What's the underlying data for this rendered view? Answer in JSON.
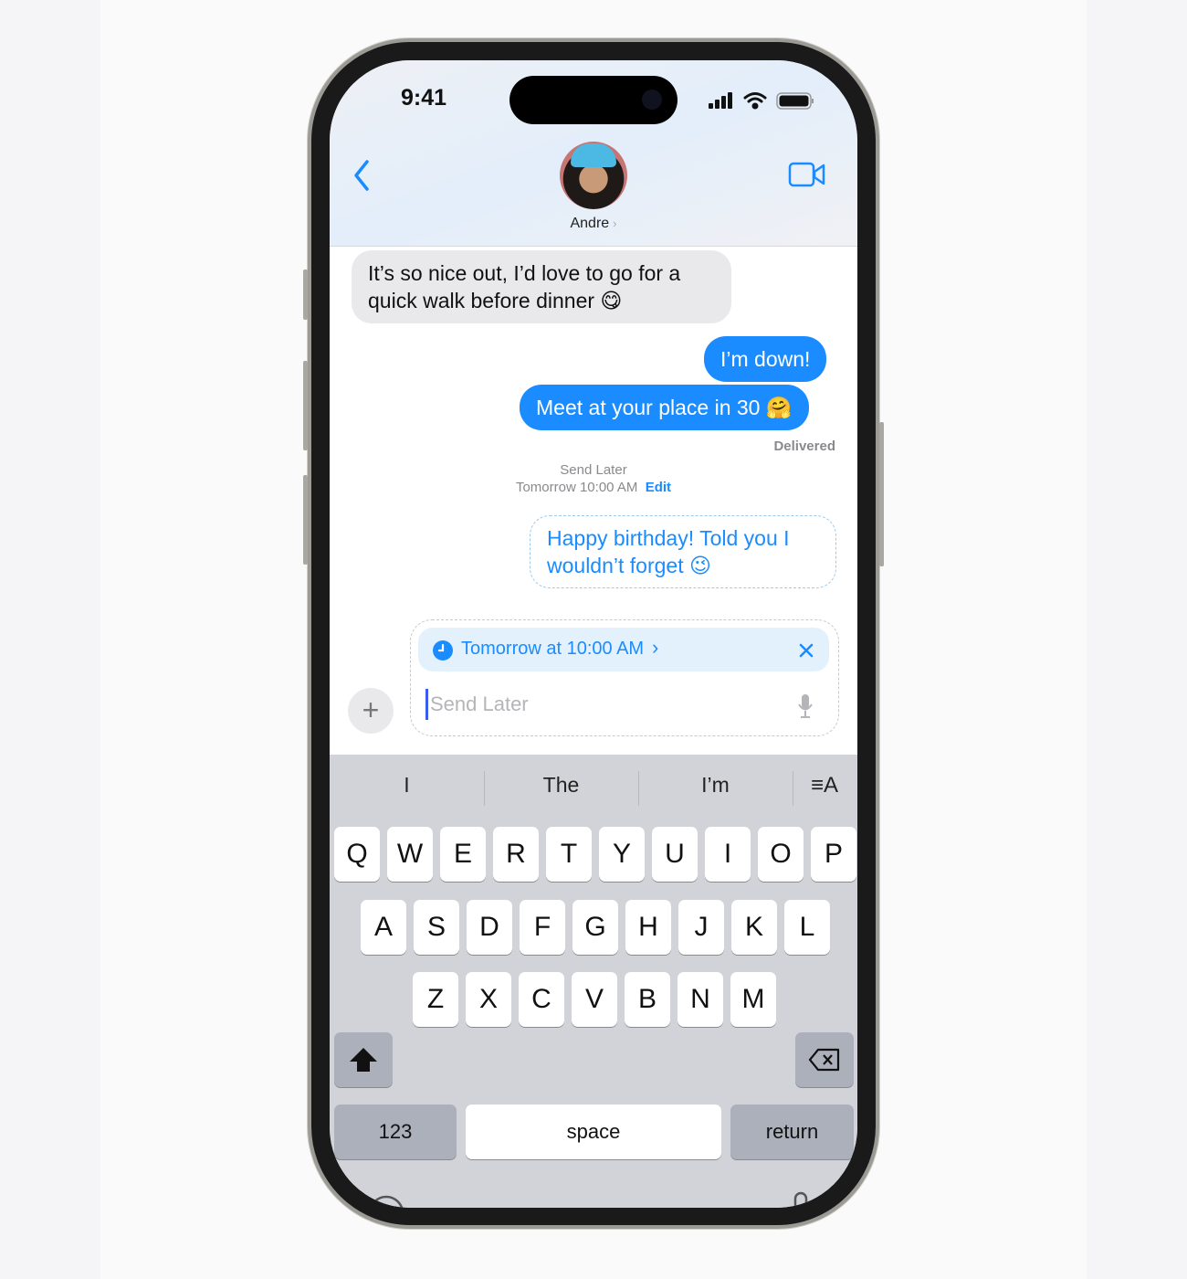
{
  "status": {
    "time": "9:41"
  },
  "header": {
    "contact_name": "Andre",
    "back_icon": "chevron-left-icon",
    "video_icon": "video-camera-icon"
  },
  "messages": [
    {
      "from": "them",
      "text": "It’s so nice out, I’d love to go for a quick walk before dinner 😋"
    },
    {
      "from": "me",
      "text": "I’m down!"
    },
    {
      "from": "me",
      "text": "Meet at your place in 30 🤗"
    }
  ],
  "delivered": "Delivered",
  "send_later": {
    "label": "Send Later",
    "time": "Tomorrow 10:00 AM",
    "edit": "Edit"
  },
  "scheduled_message": "Happy birthday! Told you I wouldn’t forget 😉",
  "compose": {
    "schedule_pill": "Tomorrow at 10:00 AM",
    "placeholder": "Send Later"
  },
  "keyboard": {
    "suggestions": [
      "I",
      "The",
      "I’m"
    ],
    "row1": [
      "Q",
      "W",
      "E",
      "R",
      "T",
      "Y",
      "U",
      "I",
      "O",
      "P"
    ],
    "row2": [
      "A",
      "S",
      "D",
      "F",
      "G",
      "H",
      "J",
      "K",
      "L"
    ],
    "row3": [
      "Z",
      "X",
      "C",
      "V",
      "B",
      "N",
      "M"
    ],
    "numbers": "123",
    "space": "space",
    "return": "return"
  },
  "colors": {
    "accent": "#1a8cff",
    "keyboard_bg": "#d1d3d9"
  }
}
